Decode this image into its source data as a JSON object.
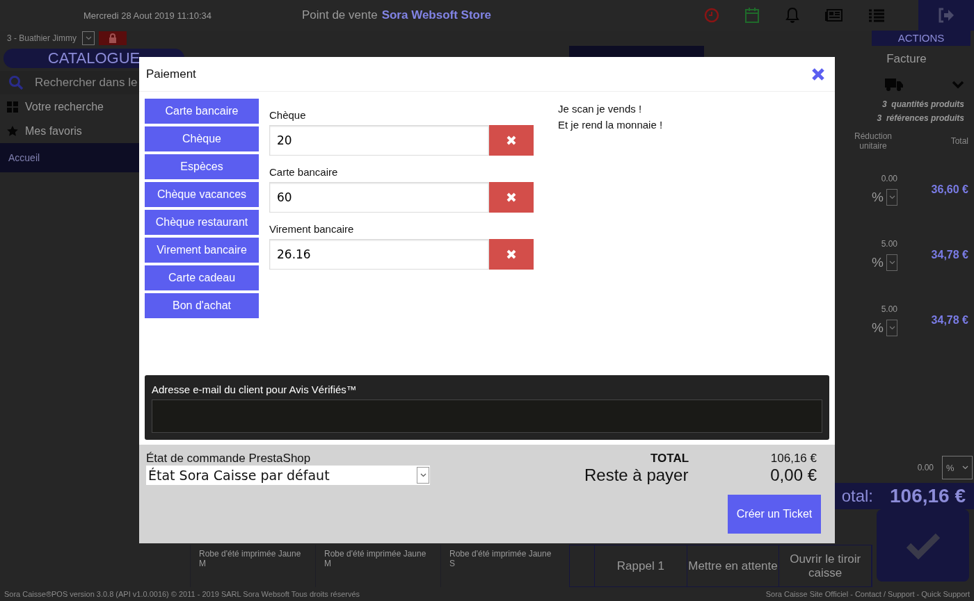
{
  "header": {
    "datetime": "Mercredi 28 Aout 2019 11:10:34",
    "title": "Point de vente",
    "store": "Sora Websoft Store"
  },
  "user": {
    "value": "3 - Buathier Jimmy"
  },
  "actions_label": "ACTIONS",
  "catalogue_label": "CATALOGUE",
  "doc_types": [
    {
      "selected": true
    },
    {
      "selected": false
    },
    {
      "label": "Facture",
      "selected": false
    }
  ],
  "sidebar": {
    "search_placeholder": "Rechercher dans le",
    "items": [
      {
        "label": "Votre recherche",
        "kind": "grid",
        "selected": false
      },
      {
        "label": "Mes favoris",
        "kind": "star",
        "selected": false
      },
      {
        "label": "Accueil",
        "kind": "plain",
        "selected": true
      }
    ]
  },
  "cart": {
    "quantities": "3",
    "quantities_label": "quantités produits",
    "references": "3",
    "references_label": "références produits",
    "columns": [
      "Réduction unitaire",
      "Total"
    ],
    "rows": [
      {
        "discount": "0.00",
        "unit": "%",
        "total": "36,60 €"
      },
      {
        "discount": "5.00",
        "unit": "%",
        "total": "34,78 €"
      },
      {
        "discount": "5.00",
        "unit": "%",
        "total": "34,78 €"
      }
    ],
    "global_discount": "0.00",
    "global_unit": "%",
    "total_label": "otal:",
    "total": "106,16 €"
  },
  "products": [
    {
      "name": "Robe d'été imprimée Jaune M"
    },
    {
      "name": "Robe d'été imprimée Jaune M"
    },
    {
      "name": "Robe d'été imprimée Jaune S"
    }
  ],
  "cart_buttons": [
    "Rappel 1",
    "Mettre en attente",
    "Ouvrir le tiroir caisse"
  ],
  "footer": {
    "copyright": "Sora Caisse®POS version 3.0.8 (API v1.0.0016) © 2011 - 2019 SARL Sora Websoft Tous droits réservés",
    "links": "Sora Caisse Site Officiel - Contact / Support - Quick Support"
  },
  "modal": {
    "title": "Paiement",
    "methods": [
      "Carte bancaire",
      "Chèque",
      "Espèces",
      "Chèque vacances",
      "Chèque restaurant",
      "Virement bancaire",
      "Carte cadeau",
      "Bon d'achat"
    ],
    "payments": [
      {
        "label": "Chèque",
        "value": "20"
      },
      {
        "label": "Carte bancaire",
        "value": "60"
      },
      {
        "label": "Virement bancaire",
        "value": "26.16"
      }
    ],
    "message": [
      "Je scan je vends !",
      "Et je rend la monnaie !"
    ],
    "email_label": "Adresse e-mail du client pour Avis Vérifiés™",
    "order_state": {
      "label": "État de commande PrestaShop",
      "value": "État Sora Caisse par défaut"
    },
    "total_label": "TOTAL",
    "total": "106,16 €",
    "remaining_label": "Reste à payer",
    "remaining": "0,00 €",
    "submit": "Créer un Ticket"
  }
}
